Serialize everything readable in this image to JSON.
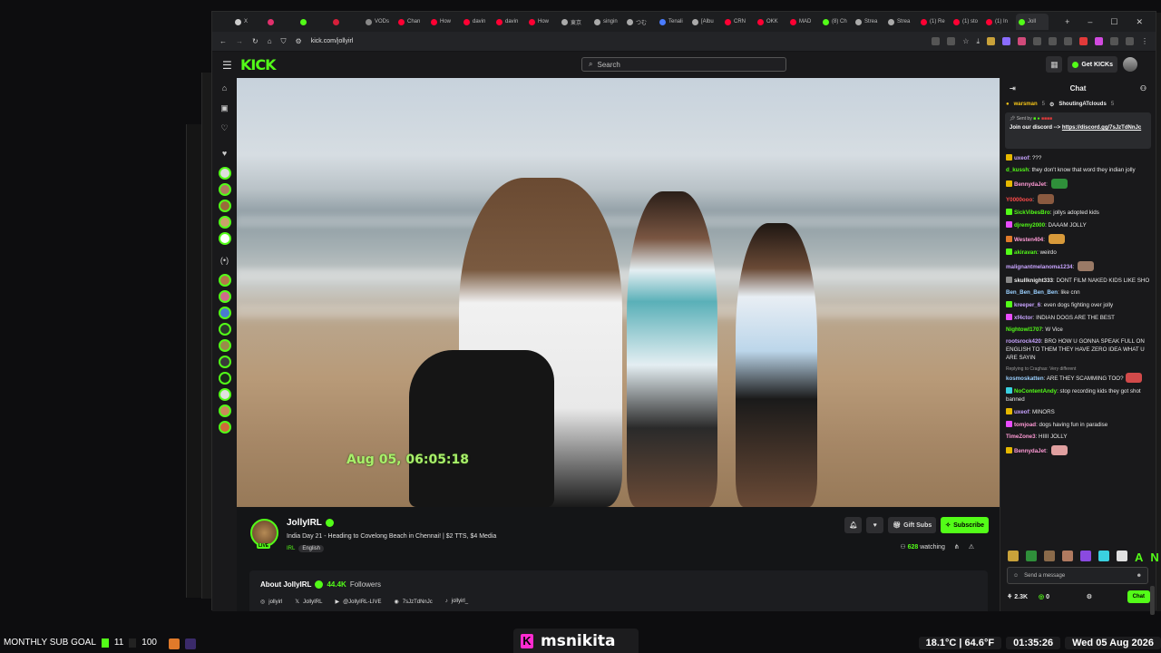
{
  "browser": {
    "tabs": [
      {
        "label": "X",
        "color": "#cccccc"
      },
      {
        "label": "",
        "color": "#e1306c"
      },
      {
        "label": "",
        "color": "#53fc18"
      },
      {
        "label": "",
        "color": "#d61f3a"
      },
      {
        "label": "VODs",
        "color": "#888888"
      },
      {
        "label": "Chan",
        "color": "#ff0033"
      },
      {
        "label": "How",
        "color": "#ff0033"
      },
      {
        "label": "davin",
        "color": "#ff0033"
      },
      {
        "label": "davin",
        "color": "#ff0033"
      },
      {
        "label": "How",
        "color": "#ff0033"
      },
      {
        "label": "東京",
        "color": "#aaaaaa"
      },
      {
        "label": "singin",
        "color": "#aaaaaa"
      },
      {
        "label": "つむ",
        "color": "#aaaaaa"
      },
      {
        "label": "Tenali",
        "color": "#4a7cff"
      },
      {
        "label": "[Albu",
        "color": "#aaaaaa"
      },
      {
        "label": "CRN",
        "color": "#ff0033"
      },
      {
        "label": "OKK",
        "color": "#ff0033"
      },
      {
        "label": "MAD",
        "color": "#ff0033"
      },
      {
        "label": "(8) Ch",
        "color": "#53fc18"
      },
      {
        "label": "Strea",
        "color": "#aaaaaa"
      },
      {
        "label": "Strea",
        "color": "#aaaaaa"
      },
      {
        "label": "(1) Re",
        "color": "#ff0033"
      },
      {
        "label": "(1) sto",
        "color": "#ff0033"
      },
      {
        "label": "(1) In",
        "color": "#ff0033"
      },
      {
        "label": "Joll",
        "color": "#53fc18"
      }
    ],
    "url": "kick.com/jollyirl",
    "new_tab": "+",
    "minimize": "–",
    "maximize": "☐",
    "close": "✕"
  },
  "kick": {
    "logo": "KICK",
    "search_placeholder": "Search",
    "get_kicks": "Get KICKs"
  },
  "video": {
    "timestamp": "Aug 05, 06:05:18"
  },
  "channel": {
    "name": "JollyIRL",
    "live_badge": "LIVE",
    "title": "India Day 21 - Heading to Covelong Beach in Chennai! | $2 TTS, $4 Media",
    "category": "IRL",
    "language": "English",
    "gift_subs": "Gift Subs",
    "subscribe": "Subscribe",
    "watching_count": "628",
    "watching_label": "watching",
    "about_title": "About JollyIRL",
    "followers_count": "44.4K",
    "followers_label": "Followers",
    "socials": [
      {
        "icon": "instagram-icon",
        "glyph": "◎",
        "label": "jollyirl"
      },
      {
        "icon": "x-icon",
        "glyph": "𝕏",
        "label": "JollyIRL"
      },
      {
        "icon": "youtube-icon",
        "glyph": "▶",
        "label": "@JollyIRL-LIVE"
      },
      {
        "icon": "discord-icon",
        "glyph": "◉",
        "label": "7sJzTdNnJc"
      },
      {
        "icon": "tiktok-icon",
        "glyph": "♪",
        "label": "jollyirl_"
      }
    ]
  },
  "chat": {
    "title": "Chat",
    "top_gifters": [
      {
        "name": "warsman",
        "count": "5"
      },
      {
        "name": "ShoutingATclouds",
        "count": "5"
      }
    ],
    "pinned": {
      "sent_by": "Sent by",
      "message": "Join our discord --> ",
      "link": "https://discord.gg/7sJzTdNnJc"
    },
    "messages": [
      {
        "user": "uxeof",
        "color": "#c8a4ff",
        "badge": "#e6b800",
        "text": "???"
      },
      {
        "user": "d_kussh",
        "color": "#53fc18",
        "badge": "",
        "text": "they don't know that word they indian jolly"
      },
      {
        "user": "BennydaJet",
        "color": "#ff9ad5",
        "badge": "#e6b800",
        "text": "",
        "emote": "#2f8f3a"
      },
      {
        "user": "Y0000ooo",
        "color": "#ff4b4b",
        "badge": "",
        "text": "",
        "emote": "#8a5a40"
      },
      {
        "user": "SickVibesBro",
        "color": "#53fc18",
        "badge": "#53fc18",
        "text": "jollys adopted kids"
      },
      {
        "user": "djremy2000",
        "color": "#53fc18",
        "badge": "#e94cff",
        "text": "DAAAM JOLLY"
      },
      {
        "user": "Westen404",
        "color": "#ff9ad5",
        "badge": "#e07a2a",
        "text": "",
        "emote": "#d89a3a"
      },
      {
        "user": "akiravan",
        "color": "#53fc18",
        "badge": "#53fc18",
        "text": "weirdo"
      },
      {
        "user": "malignantmelanoma1234",
        "color": "#c8a4ff",
        "badge": "",
        "text": "",
        "emote": "#9a7a66"
      },
      {
        "user": "skullknight333",
        "color": "#eeeeee",
        "badge": "#888888",
        "text": "DONT FILM NAKED KIDS LIKE SHO"
      },
      {
        "user": "Ben_Ben_Ben_Ben",
        "color": "#9ad0ff",
        "badge": "",
        "text": "like cnn"
      },
      {
        "user": "kreeper_6",
        "color": "#c8a4ff",
        "badge": "#53fc18",
        "text": "even dogs fighting over jolly"
      },
      {
        "user": "xf4ctor",
        "color": "#c8a4ff",
        "badge": "#e94cff",
        "text": "INDIAN DOGS ARE THE BEST"
      },
      {
        "user": "Nightowl1707",
        "color": "#53fc18",
        "badge": "",
        "text": "W Vice"
      },
      {
        "user": "rootsrock420",
        "color": "#c8a4ff",
        "badge": "",
        "text": "BRO HOW U GONNA SPEAK FULL ON ENGLISH TO THEM THEY HAVE ZERO IDEA WHAT U ARE SAYIN"
      },
      {
        "user": "kosmoskatten",
        "color": "#9ad0ff",
        "badge": "",
        "reply": "Replying to Craghas: Very different",
        "text": "ARE THEY SCAMMING TOO?",
        "emote": "#d14a4a"
      },
      {
        "user": "NoContentAndy",
        "color": "#53fc18",
        "badge": "#3ad0e0",
        "text": "stop recording kids they got shot banned"
      },
      {
        "user": "uxeof",
        "color": "#c8a4ff",
        "badge": "#e6b800",
        "text": "MINORS"
      },
      {
        "user": "tomjoad",
        "color": "#ff9ad5",
        "badge": "#e94cff",
        "text": "dogs having fun in paradise"
      },
      {
        "user": "TimeZone3",
        "color": "#ff9ad5",
        "badge": "",
        "text": "HIIII JOLLY"
      },
      {
        "user": "BennydaJet",
        "color": "#ff9ad5",
        "badge": "#e6b800",
        "text": "",
        "emote": "#e0a0a0"
      }
    ],
    "input_placeholder": "Send a message",
    "points": "2.3K",
    "kicks": "0",
    "chat_button": "Chat"
  },
  "overlay": {
    "sub_goal_label": "MONTHLY SUB GOAL",
    "sub_goal_current": "11",
    "sub_goal_target": "100",
    "streamer_badge": "K",
    "streamer_name": "msnikita",
    "temperature": "18.1°C | 64.6°F",
    "time": "01:35:26",
    "date": "Wed 05 Aug 2026"
  }
}
